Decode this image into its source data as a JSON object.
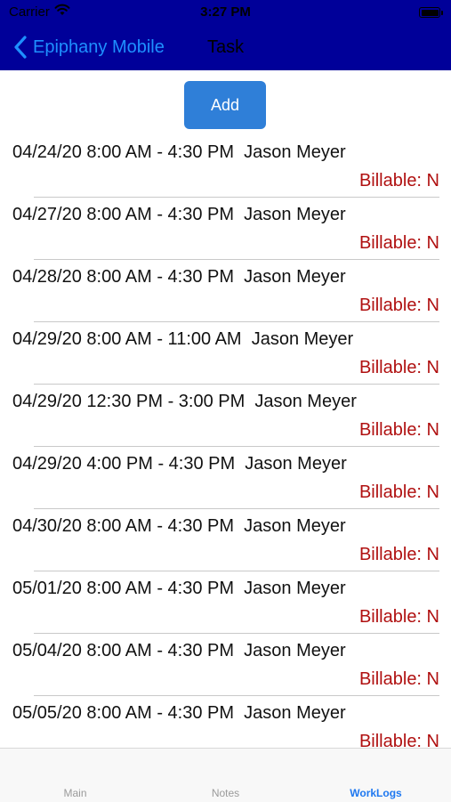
{
  "status_bar": {
    "carrier": "Carrier",
    "time": "3:27 PM",
    "wifi_icon": "wifi-icon",
    "battery_icon": "battery-icon"
  },
  "nav_bar": {
    "back_label": "Epiphany Mobile",
    "title": "Task",
    "back_icon": "chevron-left-icon",
    "back_color": "#1e90ff",
    "background": "#000099"
  },
  "add_button": {
    "label": "Add",
    "color": "#2f7fd8"
  },
  "worklogs": [
    {
      "entry": "04/24/20 8:00 AM - 4:30 PM  Jason Meyer",
      "billable": "Billable: N"
    },
    {
      "entry": "04/27/20 8:00 AM - 4:30 PM  Jason Meyer",
      "billable": "Billable: N"
    },
    {
      "entry": "04/28/20 8:00 AM - 4:30 PM  Jason Meyer",
      "billable": "Billable: N"
    },
    {
      "entry": "04/29/20 8:00 AM - 11:00 AM  Jason Meyer",
      "billable": "Billable: N"
    },
    {
      "entry": "04/29/20 12:30 PM - 3:00 PM  Jason Meyer",
      "billable": "Billable: N"
    },
    {
      "entry": "04/29/20 4:00 PM - 4:30 PM  Jason Meyer",
      "billable": "Billable: N"
    },
    {
      "entry": "04/30/20 8:00 AM - 4:30 PM  Jason Meyer",
      "billable": "Billable: N"
    },
    {
      "entry": "05/01/20 8:00 AM - 4:30 PM  Jason Meyer",
      "billable": "Billable: N"
    },
    {
      "entry": "05/04/20 8:00 AM - 4:30 PM  Jason Meyer",
      "billable": "Billable: N"
    },
    {
      "entry": "05/05/20 8:00 AM - 4:30 PM  Jason Meyer",
      "billable": "Billable: N"
    }
  ],
  "tab_bar": {
    "tabs": [
      {
        "label": "Main",
        "active": false
      },
      {
        "label": "Notes",
        "active": false
      },
      {
        "label": "WorkLogs",
        "active": true
      }
    ],
    "active_color": "#1e78f0"
  }
}
